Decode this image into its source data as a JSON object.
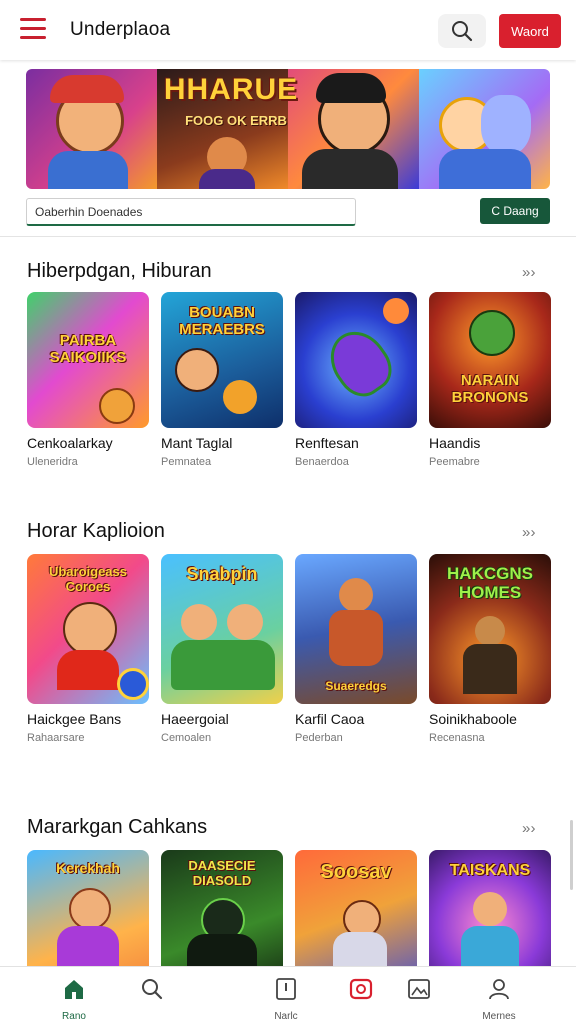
{
  "header": {
    "title": "Underplaoa",
    "cta_label": "Waord",
    "menu_icon": "hamburger-menu-icon",
    "search_icon": "search-icon"
  },
  "banner": {
    "headline": "HHARUE",
    "subline": "FOOG OK ERRB"
  },
  "search": {
    "value": "Oaberhin Doenades",
    "button_label": "C Daang"
  },
  "sections": [
    {
      "title": "Hiberpdgan, Hiburan",
      "arrow": "» ›",
      "cards": [
        {
          "title": "Cenkoalarkay",
          "subtitle": "Uleneridra",
          "art": "PAIRBA SAIKOIIKS"
        },
        {
          "title": "Mant Taglal",
          "subtitle": "Pemnatea",
          "art": "BOUABN MERAEBRS"
        },
        {
          "title": "Renftesan",
          "subtitle": "Benaerdoa",
          "art": ""
        },
        {
          "title": "Haandis",
          "subtitle": "Peemabre",
          "art": "NARAIN BRONONS"
        }
      ]
    },
    {
      "title": "Horar Kaplioion",
      "arrow": "» ›",
      "cards": [
        {
          "title": "Haickgee Bans",
          "subtitle": "Rahaarsare",
          "art": "Ubaroigeass Coroes"
        },
        {
          "title": "Haeergoial",
          "subtitle": "Cemoalen",
          "art": "Snabpin"
        },
        {
          "title": "Karfil Caoa",
          "subtitle": "Pederban",
          "art": "Suaeredgs"
        },
        {
          "title": "Soinikhaboole",
          "subtitle": "Recenasna",
          "art": "HAKCGNS HOMES"
        }
      ]
    },
    {
      "title": "Mararkgan Cahkans",
      "arrow": "» ›",
      "cards": [
        {
          "title": "",
          "subtitle": "",
          "art": "Kerekhah"
        },
        {
          "title": "",
          "subtitle": "",
          "art": "DAASECIE DIASOLD"
        },
        {
          "title": "",
          "subtitle": "",
          "art": "Soosav"
        },
        {
          "title": "",
          "subtitle": "",
          "art": "TAISKANS"
        }
      ]
    }
  ],
  "nav": {
    "items": [
      {
        "label": "Rano",
        "icon": "home-icon"
      },
      {
        "label": "",
        "icon": "search-icon"
      },
      {
        "label": "Narlc",
        "icon": "upload-icon"
      },
      {
        "label": "",
        "icon": "play-icon"
      },
      {
        "label": "",
        "icon": "edit-image-icon"
      },
      {
        "label": "Mernes",
        "icon": "profile-icon"
      }
    ]
  },
  "colors": {
    "brand_red": "#d9202e",
    "accent_green": "#17573a"
  }
}
